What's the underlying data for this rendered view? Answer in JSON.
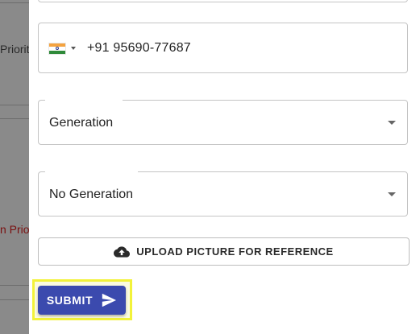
{
  "background_page": {
    "fragment_1": "Priorit",
    "fragment_2": "n Prio"
  },
  "form": {
    "phone": {
      "country_flag": "india-flag-icon",
      "value": "+91 95690-77687"
    },
    "select_1": {
      "value": "Generation"
    },
    "select_2": {
      "value": "No Generation"
    },
    "upload_button": {
      "label": "UPLOAD PICTURE FOR REFERENCE",
      "icon": "cloud-upload-icon"
    },
    "submit_button": {
      "label": "SUBMIT",
      "icon": "send-icon"
    }
  },
  "colors": {
    "primary": "#3b4aae",
    "highlight": "#f2f23a",
    "accent_red": "#7a1010"
  }
}
